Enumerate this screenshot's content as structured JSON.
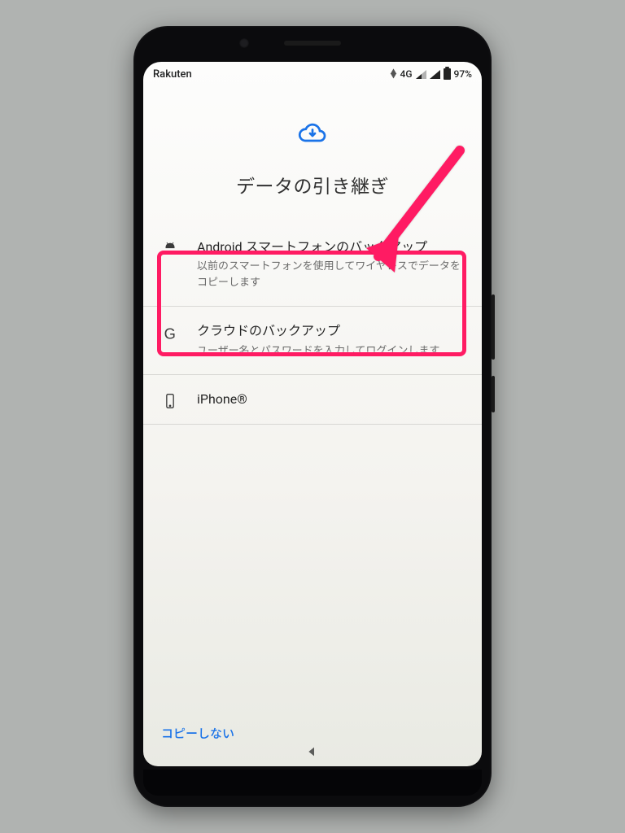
{
  "statusbar": {
    "carrier": "Rakuten",
    "network": "4G",
    "battery_pct": "97%"
  },
  "header": {
    "title": "データの引き継ぎ"
  },
  "options": [
    {
      "icon": "android-icon",
      "title": "Android スマートフォンのバックアップ",
      "subtitle": "以前のスマートフォンを使用してワイヤレスでデータをコピーします"
    },
    {
      "icon": "google-g-icon",
      "title": "クラウドのバックアップ",
      "subtitle": "ユーザー名とパスワードを入力してログインします"
    },
    {
      "icon": "iphone-icon",
      "title": "iPhone®",
      "subtitle": ""
    }
  ],
  "footer": {
    "skip_label": "コピーしない"
  },
  "annotation": {
    "highlight_color": "#ff1b63"
  }
}
